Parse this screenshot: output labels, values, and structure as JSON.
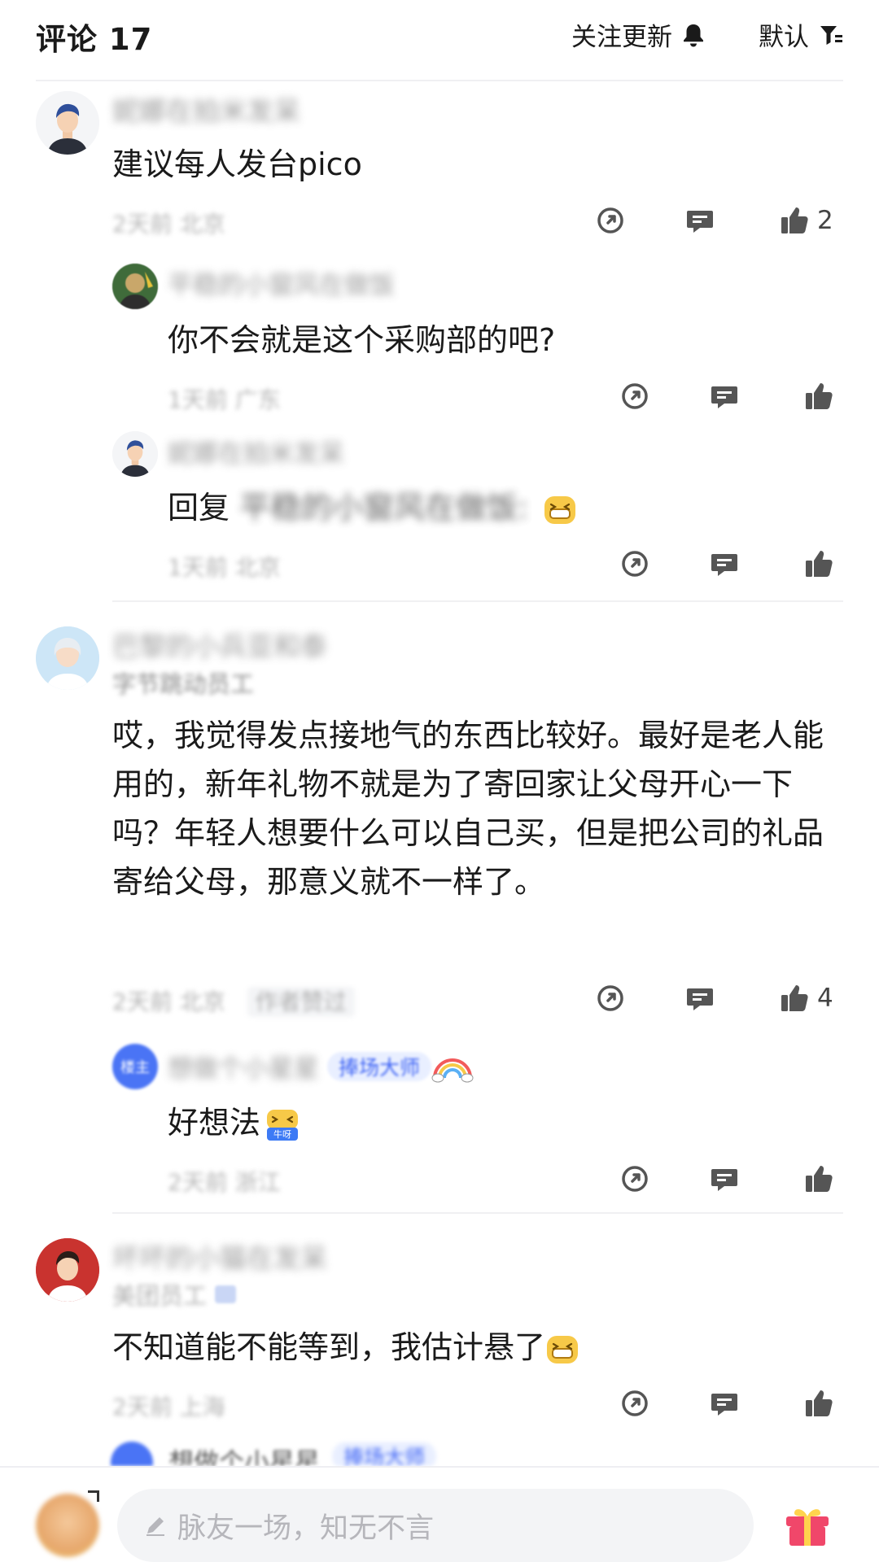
{
  "header": {
    "title": "评论 17",
    "follow_label": "关注更新",
    "sort_label": "默认"
  },
  "colors": {
    "accent": "#3d63f5",
    "badge_bg": "#e9efff",
    "muted": "#b4b4b4"
  },
  "comments": [
    {
      "name": "妮娜在拍米发呆",
      "content": "建议每人发台pico",
      "meta": "2天前 北京",
      "likes": "2",
      "replies": [
        {
          "name": "平稳的小窗风在做饭",
          "content": "你不会就是这个采购部的吧?",
          "meta": "1天前 广东"
        },
        {
          "name": "妮娜在拍米发呆",
          "reply_prefix": "回复",
          "reply_target": "平稳的小窗风在做饭:",
          "meta": "1天前 北京"
        }
      ]
    },
    {
      "name": "巴黎的小兵亚和泰",
      "subtitle": "字节跳动员工",
      "content": "哎，我觉得发点接地气的东西比较好。最好是老人能用的，新年礼物不就是为了寄回家让父母开心一下吗？年轻人想要什么可以自己买，但是把公司的礼品寄给父母，那意义就不一样了。",
      "meta": "2天前 北京",
      "meta_extra": "作者赞过",
      "likes": "4",
      "replies": [
        {
          "landlord": "楼主",
          "name": "想做个小星星",
          "badge": "捧场大师",
          "content": "好想法",
          "emoji_label": "牛呀",
          "meta": "2天前 浙江"
        }
      ]
    },
    {
      "name": "坏坏的小猫在发呆",
      "subtitle": "美团员工",
      "content": "不知道能不能等到，我估计悬了",
      "meta": "2天前 上海",
      "replies_peek": {
        "name": "想做个小星星",
        "badge": "捧场大师"
      }
    }
  ],
  "bottom": {
    "input_placeholder": "脉友一场，知无不言"
  }
}
